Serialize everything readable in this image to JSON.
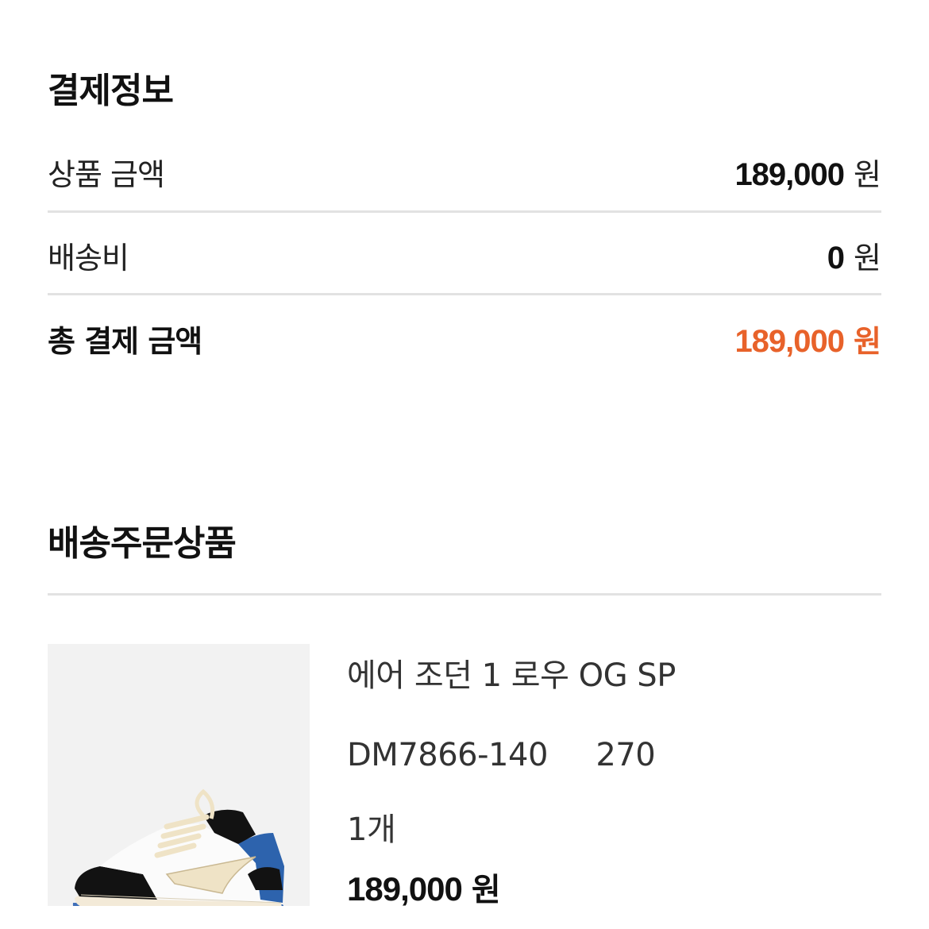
{
  "payment": {
    "title": "결제정보",
    "rows": [
      {
        "label": "상품 금액",
        "amount": "189,000",
        "unit": "원"
      },
      {
        "label": "배송비",
        "amount": "0",
        "unit": "원"
      }
    ],
    "total": {
      "label": "총 결제 금액",
      "amount": "189,000",
      "unit": "원"
    }
  },
  "order": {
    "title": "배송주문상품",
    "product": {
      "name": "에어 조던 1 로우 OG SP",
      "style_code": "DM7866-140",
      "size": "270",
      "quantity": "1개",
      "price": "189,000",
      "unit": "원",
      "image_icon": "sneaker-image"
    }
  },
  "colors": {
    "accent": "#e8622a",
    "divider": "#e2e2e2",
    "image_bg": "#f2f2f2"
  }
}
